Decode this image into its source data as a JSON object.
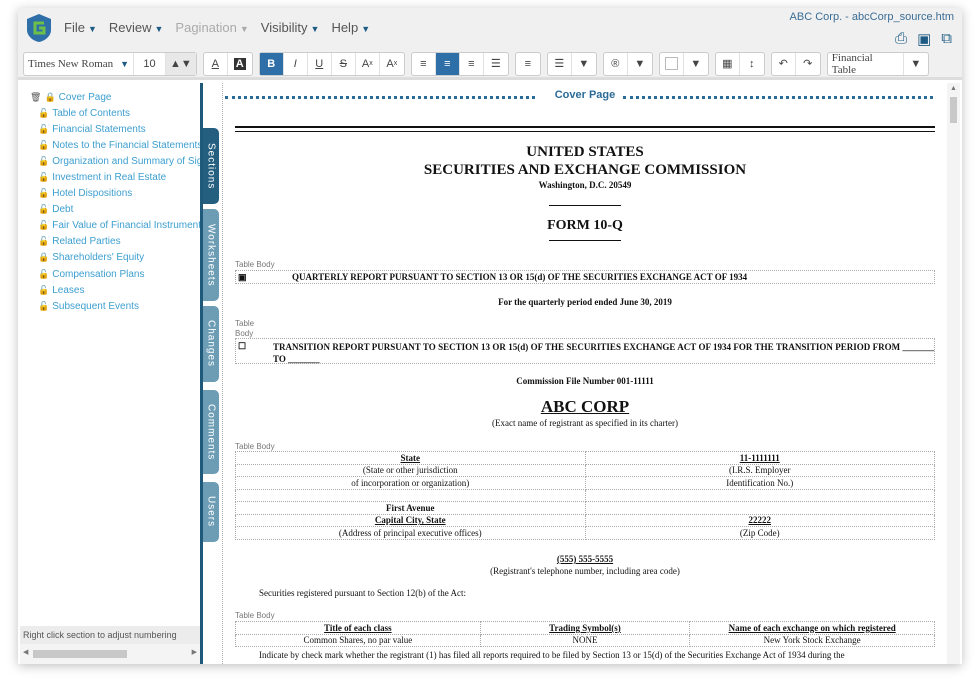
{
  "app": {
    "title": "ABC Corp. - abcCorp_source.htm",
    "menu": [
      "File",
      "Review",
      "Pagination",
      "Visibility",
      "Help"
    ],
    "icons": [
      "print-icon",
      "save-icon",
      "copy-icon"
    ]
  },
  "toolbar": {
    "font": "Times New Roman",
    "size": "10",
    "format": "Financial Table",
    "accent": "#2f6fa8"
  },
  "sidebar": {
    "items": [
      "Cover Page",
      "Table of Contents",
      "Financial Statements",
      "Notes to the Financial Statements",
      "Organization and Summary of Significant Accounting Policies",
      "Investment in Real Estate",
      "Hotel Dispositions",
      "Debt",
      "Fair Value of Financial Instruments",
      "Related Parties",
      "Shareholders' Equity",
      "Compensation Plans",
      "Leases",
      "Subsequent Events"
    ],
    "hint": "Right click section to adjust numbering"
  },
  "tabs": [
    "Sections",
    "Worksheets",
    "Changes",
    "Comments",
    "Users"
  ],
  "doc": {
    "banner": "Cover Page",
    "h1": "UNITED STATES",
    "h2": "SECURITIES AND EXCHANGE COMMISSION",
    "city": "Washington, D.C. 20549",
    "form": "FORM 10-Q",
    "tb": "Table Body",
    "tb1": "Table",
    "tb2": "Body",
    "quarterly": "QUARTERLY REPORT PURSUANT TO SECTION 13 OR 15(d) OF THE SECURITIES EXCHANGE ACT OF 1934",
    "period": "For the quarterly period ended June 30, 2019",
    "transition": "TRANSITION REPORT PURSUANT TO SECTION 13 OR 15(d) OF THE SECURITIES EXCHANGE ACT OF 1934 FOR THE TRANSITION PERIOD FROM _______ TO _______",
    "file": "Commission File Number 001-11111",
    "company": "ABC CORP",
    "company_sub": "(Exact name of registrant as specified in its charter)",
    "reg_table": [
      [
        "State",
        "11-1111111"
      ],
      [
        "(State or other jurisdiction",
        "(I.R.S. Employer"
      ],
      [
        "of incorporation or organization)",
        "Identification No.)"
      ],
      [
        "",
        ""
      ],
      [
        "First Avenue",
        ""
      ],
      [
        "Capital City, State",
        "22222"
      ],
      [
        "(Address of principal executive offices)",
        "(Zip Code)"
      ]
    ],
    "phone": "(555) 555-5555",
    "phone_sub": "(Registrant's telephone number, including area code)",
    "sec12": "Securities registered pursuant to Section 12(b) of the Act:",
    "sec_headers": [
      "Title of each class",
      "Trading Symbol(s)",
      "Name of each exchange on which registered"
    ],
    "sec_row": [
      "Common Shares, no par value",
      "NONE",
      "New York Stock Exchange"
    ],
    "indicate": "Indicate by check mark whether the registrant (1) has filed all reports required to be filed by Section 13 or 15(d) of the Securities Exchange Act of 1934 during the"
  }
}
